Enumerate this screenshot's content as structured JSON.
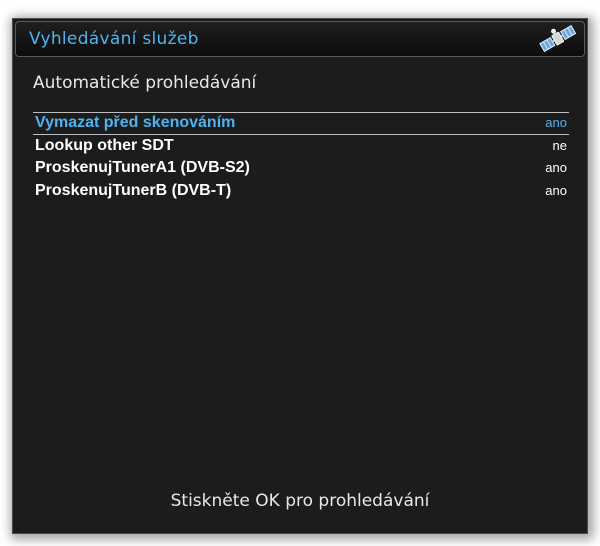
{
  "window": {
    "title": "Vyhledávání služeb",
    "icon": "satellite-icon",
    "accent_color": "#4fb3f0"
  },
  "section": {
    "title": "Automatické prohledávání"
  },
  "settings": [
    {
      "label": "Vymazat před skenováním",
      "value": "ano",
      "selected": true
    },
    {
      "label": "Lookup other SDT",
      "value": "ne",
      "selected": false
    },
    {
      "label": "ProskenujTunerA1 (DVB-S2)",
      "value": "ano",
      "selected": false
    },
    {
      "label": "ProskenujTunerB (DVB-T)",
      "value": "ano",
      "selected": false
    }
  ],
  "footer": {
    "hint": "Stiskněte OK pro prohledávání"
  }
}
